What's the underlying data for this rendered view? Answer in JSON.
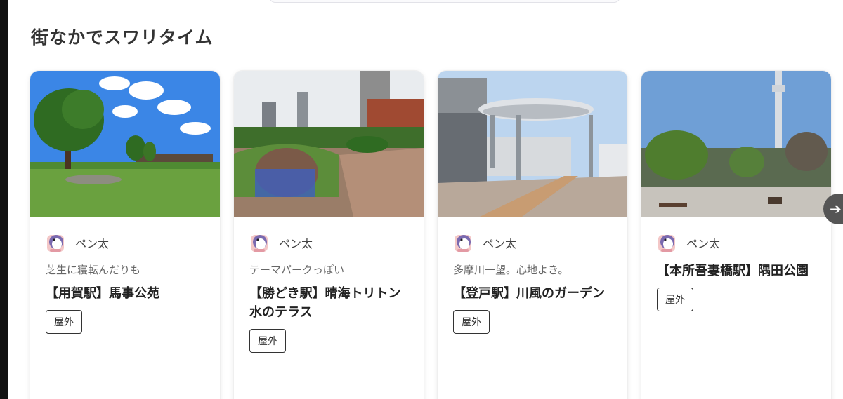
{
  "section": {
    "title": "街なかでスワリタイム"
  },
  "cards": [
    {
      "author": "ペン太",
      "catch": "芝生に寝転んだりも",
      "place": "【用賀駅】馬事公苑",
      "tag": "屋外",
      "photo_icon": "park-lawn-photo"
    },
    {
      "author": "ペン太",
      "catch": "テーマパークっぽい",
      "place": "【勝どき駅】晴海トリトン水のテラス",
      "tag": "屋外",
      "photo_icon": "rooftop-garden-photo"
    },
    {
      "author": "ペン太",
      "catch": "多摩川一望。心地よき。",
      "place": "【登戸駅】川風のガーデン",
      "tag": "屋外",
      "photo_icon": "canopy-terrace-photo"
    },
    {
      "author": "ペン太",
      "catch": "",
      "place": "【本所吾妻橋駅】隅田公園",
      "tag": "屋外",
      "photo_icon": "tower-park-photo"
    }
  ],
  "carousel": {
    "next_icon": "arrow-right-icon"
  },
  "colors": {
    "text": "#222222",
    "subtext": "#666666",
    "arrow_bg": "#555555"
  }
}
